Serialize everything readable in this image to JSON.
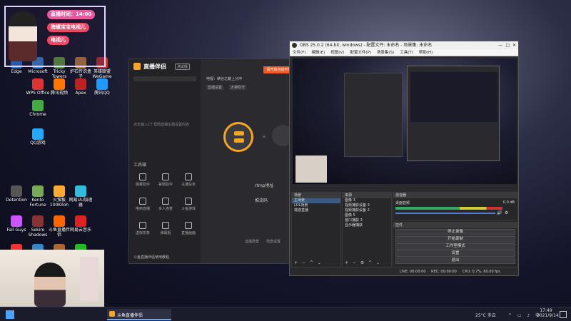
{
  "desktop_icons": [
    {
      "label": "Edge",
      "color": "#2a7be4"
    },
    {
      "label": "Microsoft",
      "color": "#3a8ee6"
    },
    {
      "label": "Tricky Towers",
      "color": "#6a4"
    },
    {
      "label": "炉石传说盒子",
      "color": "#c84"
    },
    {
      "label": "英雄联盟 WeGame",
      "color": "#c33"
    },
    {
      "label": "WPS Office",
      "color": "#d33"
    },
    {
      "label": "腾讯视频",
      "color": "#f70"
    },
    {
      "label": "Apex",
      "color": "#b22"
    },
    {
      "label": "腾讯QQ",
      "color": "#29f"
    },
    {
      "label": "Chrome",
      "color": "#4a4"
    },
    {
      "label": "QQ游戏",
      "color": "#2af"
    },
    {
      "label": "Detention",
      "color": "#555"
    },
    {
      "label": "Kento Fortune",
      "color": "#7a5"
    },
    {
      "label": "火萤板 100Kiloh",
      "color": "#fa3"
    },
    {
      "label": "网易UU加速器",
      "color": "#3bd"
    },
    {
      "label": "Fall Guys",
      "color": "#c5f"
    },
    {
      "label": "Sekiro Shadows",
      "color": "#833"
    },
    {
      "label": "斗鱼直播伴侣",
      "color": "#f60"
    },
    {
      "label": "网易云音乐",
      "color": "#d22"
    },
    {
      "label": "Flash Repair",
      "color": "#e33"
    },
    {
      "label": "setupkyp",
      "color": "#38c"
    },
    {
      "label": "魔兽八局",
      "color": "#a63"
    },
    {
      "label": "微信",
      "color": "#2b2"
    }
  ],
  "overlay": {
    "time_label": "直播时间：14:00",
    "item1": "海螺宝宝电视儿",
    "item2": "电视儿"
  },
  "app": {
    "title": "直播伴侣",
    "badge": "测试版",
    "start_button": "请开启自动开播",
    "channel_label": "电视：峡谷之巅上分冲",
    "tags": [
      "直播设置",
      "大神吹守"
    ],
    "hint": "点击输入CT 帮助直播主题设置内容",
    "tools_label": "工具箱",
    "tools": [
      "弹幕助手",
      "答题助手",
      "主播任务",
      "电商直播",
      "多人连麦",
      "斗鱼游戏",
      "虚拟形象",
      "弹幕姬",
      "直播画面"
    ],
    "rtmp_label": "rtmp地址",
    "stream_key_label": "推流码",
    "bottom_text": "斗鱼直播伴侣使用教程",
    "scene_labels": [
      "直播场景",
      "场景设置"
    ]
  },
  "obs": {
    "title": "OBS 25.0.2 (64-bit, windows) - 配置文件: 未命名 - 场景集: 未命名",
    "menu": [
      "文件(F)",
      "编辑(E)",
      "视图(V)",
      "配置文件(P)",
      "场景集(S)",
      "工具(T)",
      "帮助(H)"
    ],
    "scenes_header": "场景",
    "scenes": [
      "主场景",
      "LOL场景",
      "端游直播"
    ],
    "sources_header": "来源",
    "sources": [
      "图像 3",
      "视频捕获设备 3",
      "视频捕获设备 2",
      "图像 5",
      "窗口捕获 3",
      "显示器捕获"
    ],
    "mixer_header": "混音器",
    "mixer_track": "桌面音频",
    "mixer_value": "0.0 dB",
    "controls_header": "控件",
    "controls": [
      "停止录像",
      "开始录制",
      "工作室模式",
      "设置",
      "退出"
    ],
    "status": {
      "live": "LIVE: 00:00:00",
      "rec": "REC: 00:00:00",
      "cpu": "CPU: 0.7%, 60.00 fps"
    }
  },
  "taskbar": {
    "app_label": "斗鱼直播伴侣",
    "weather": "25°C 多云",
    "time": "17:49",
    "date": "2021/9/14"
  }
}
